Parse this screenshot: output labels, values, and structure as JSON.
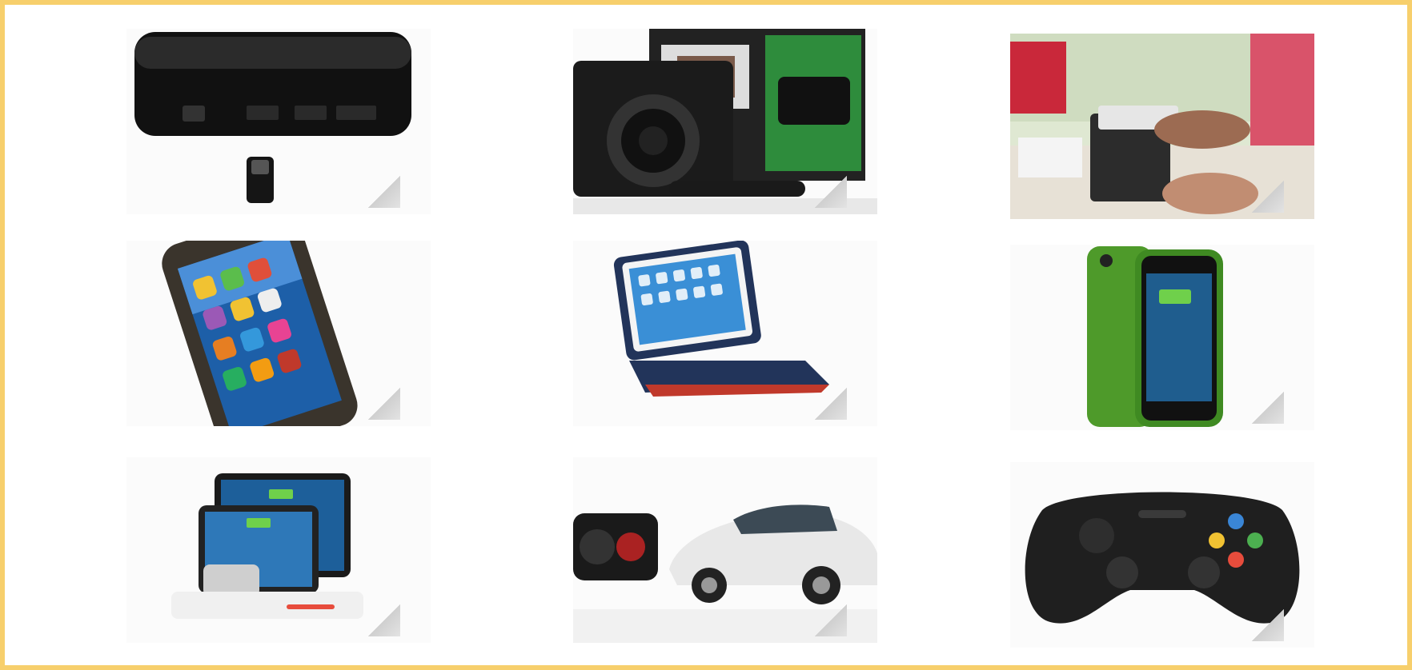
{
  "gallery": {
    "items": [
      {
        "name": "media-streamer-box"
      },
      {
        "name": "camera-with-box"
      },
      {
        "name": "printer-hands"
      },
      {
        "name": "phone-in-case"
      },
      {
        "name": "tablet-keyboard-folio"
      },
      {
        "name": "phone-battery-case"
      },
      {
        "name": "charging-station-devices"
      },
      {
        "name": "white-sports-car"
      },
      {
        "name": "game-controller"
      }
    ],
    "colors": {
      "border": "#f7cf6c",
      "background": "#ffffff",
      "green_case": "#5aa62f",
      "navy_folio": "#22345a"
    }
  }
}
